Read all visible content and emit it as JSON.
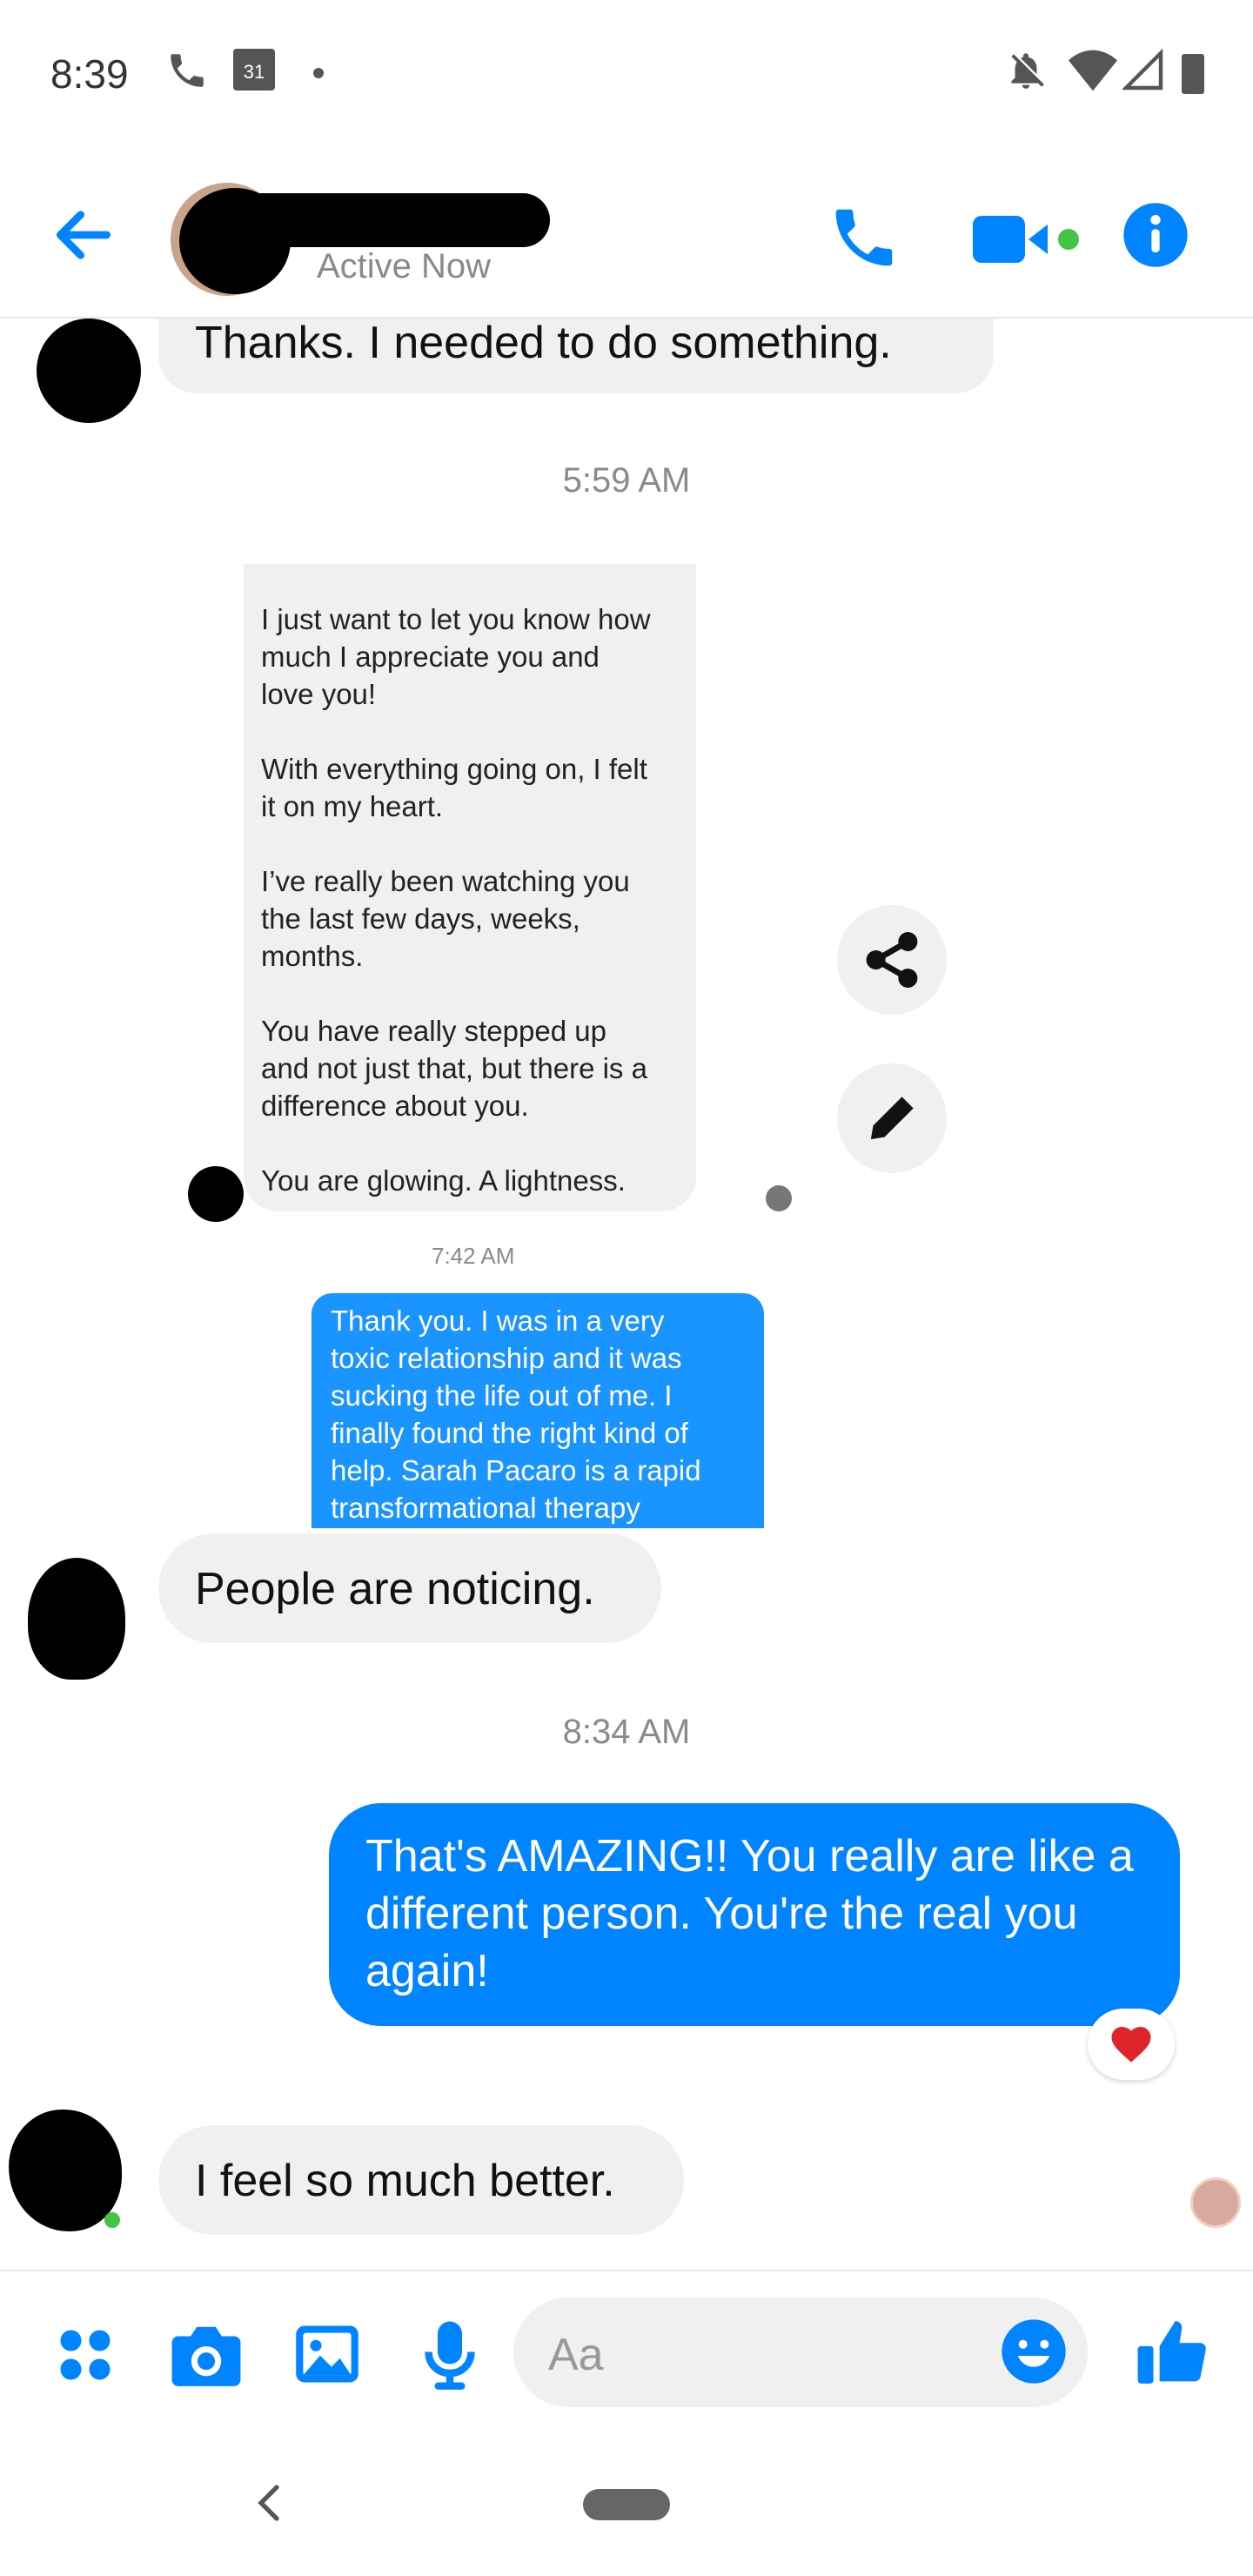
{
  "status_bar": {
    "time": "8:39",
    "calendar_day": "31"
  },
  "header": {
    "status": "Active Now"
  },
  "messages": {
    "m1": "Thanks.  I needed to do something.",
    "ts1": "5:59 AM",
    "shot_in": "I just want to let you know how\nmuch I appreciate you and\nlove you!\n\nWith everything going on, I felt\nit on my heart.\n\nI’ve really been watching you\nthe last few days, weeks,\nmonths.\n\nYou have really stepped up\nand not just that, but there is a\ndifference about you.\n\nYou are glowing.  A lightness.",
    "ts_shot": "7:42 AM",
    "shot_out": "Thank you.  I was in a very\ntoxic relationship and it was\nsucking the life out of me.  I\nfinally found the right kind of\nhelp.  Sarah Pacaro is a rapid\ntransformational therapy",
    "m2": "People are noticing.",
    "ts2": "8:34 AM",
    "m3": "That's AMAZING!! You really are like a different person. You're the real you again!",
    "reaction": "❤️",
    "m4": "I feel so much better."
  },
  "composer": {
    "placeholder": "Aa"
  },
  "colors": {
    "accent": "#0084ff",
    "incoming": "#f0f0f0",
    "online": "#44c444"
  }
}
